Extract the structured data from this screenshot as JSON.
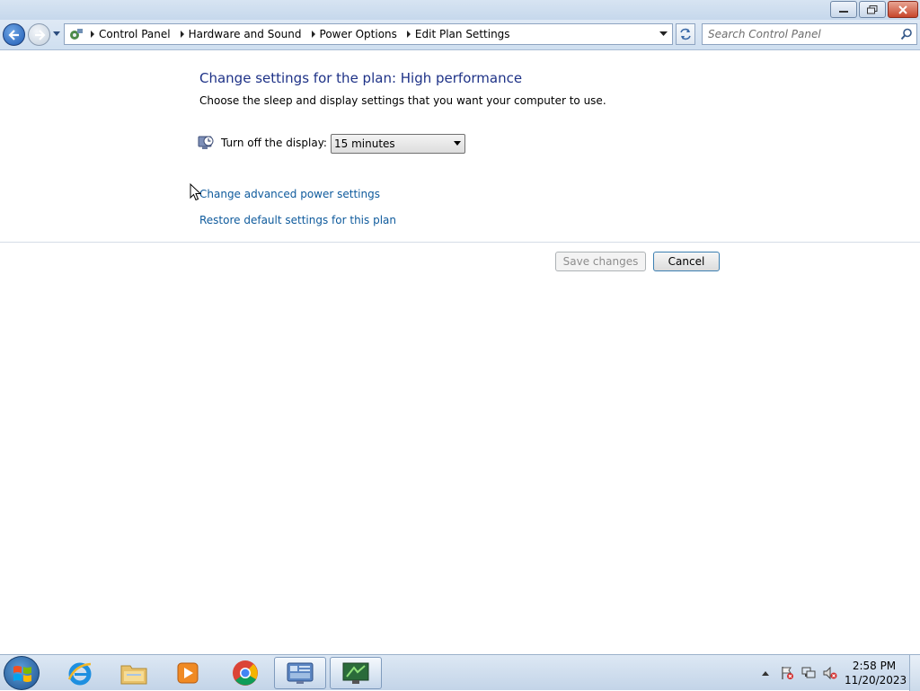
{
  "window": {
    "caption": {
      "minimize": "minimize",
      "restore": "restore",
      "close": "close"
    }
  },
  "navigation": {
    "breadcrumbs": [
      "Control Panel",
      "Hardware and Sound",
      "Power Options",
      "Edit Plan Settings"
    ],
    "search_placeholder": "Search Control Panel"
  },
  "main": {
    "heading": "Change settings for the plan: High performance",
    "description": "Choose the sleep and display settings that you want your computer to use.",
    "display_setting": {
      "label": "Turn off the display:",
      "selected": "15 minutes"
    },
    "links": {
      "advanced": "Change advanced power settings",
      "restore": "Restore default settings for this plan"
    },
    "buttons": {
      "save": "Save changes",
      "cancel": "Cancel"
    }
  },
  "taskbar": {
    "apps": [
      "internet-explorer",
      "windows-explorer",
      "media-player",
      "chrome",
      "control-panel",
      "remote-desktop"
    ],
    "clock": {
      "time": "2:58 PM",
      "date": "11/20/2023"
    }
  },
  "colors": {
    "heading": "#1e3287",
    "link": "#0e5a9c",
    "disabled_text": "#8d8d8d"
  }
}
